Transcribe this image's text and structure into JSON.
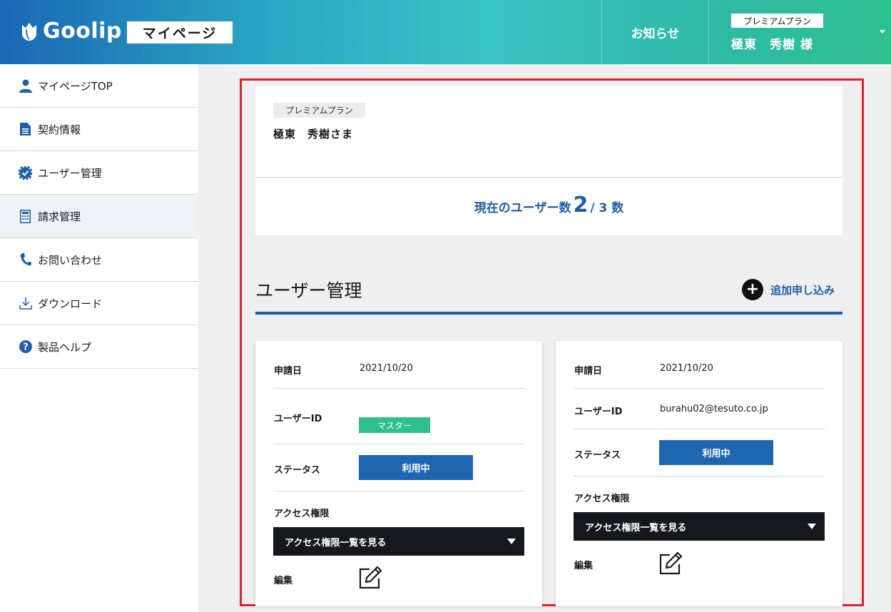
{
  "header": {
    "logo_text": "Goolip",
    "mypage_label": "マイページ",
    "notice_label": "お知らせ",
    "plan_label": "プレミアムプラン",
    "user_name": "極東　秀樹 様"
  },
  "sidebar": {
    "items": [
      {
        "label": "マイページTOP",
        "icon": "user-icon"
      },
      {
        "label": "契約情報",
        "icon": "document-icon"
      },
      {
        "label": "ユーザー管理",
        "icon": "gear-check-icon"
      },
      {
        "label": "請求管理",
        "icon": "calculator-icon",
        "active": true
      },
      {
        "label": "お問い合わせ",
        "icon": "phone-icon"
      },
      {
        "label": "ダウンロード",
        "icon": "download-icon"
      },
      {
        "label": "製品ヘルプ",
        "icon": "help-icon"
      }
    ]
  },
  "plan_card": {
    "plan_label": "プレミアムプラン",
    "user_name": "極東　秀樹さま",
    "count_prefix": "現在のユーザー数",
    "count_current": "2",
    "count_suffix": "/ 3 数"
  },
  "section": {
    "title": "ユーザー管理",
    "add_label": "追加申し込み"
  },
  "cards": [
    {
      "date_label": "申請日",
      "date_value": "2021/10/20",
      "userid_label": "ユーザーID",
      "userid_badge": "マスター",
      "status_label": "ステータス",
      "status_value": "利用中",
      "access_label": "アクセス権限",
      "access_select": "アクセス権限一覧を見る",
      "edit_label": "編集"
    },
    {
      "date_label": "申請日",
      "date_value": "2021/10/20",
      "userid_label": "ユーザーID",
      "userid_value": "burahu02@tesuto.co.jp",
      "status_label": "ステータス",
      "status_value": "利用中",
      "access_label": "アクセス権限",
      "access_select": "アクセス権限一覧を見る",
      "edit_label": "編集"
    }
  ],
  "colors": {
    "accent_blue": "#1e5fa8",
    "master_green": "#2dbf8d",
    "highlight_red": "#e0202a"
  }
}
